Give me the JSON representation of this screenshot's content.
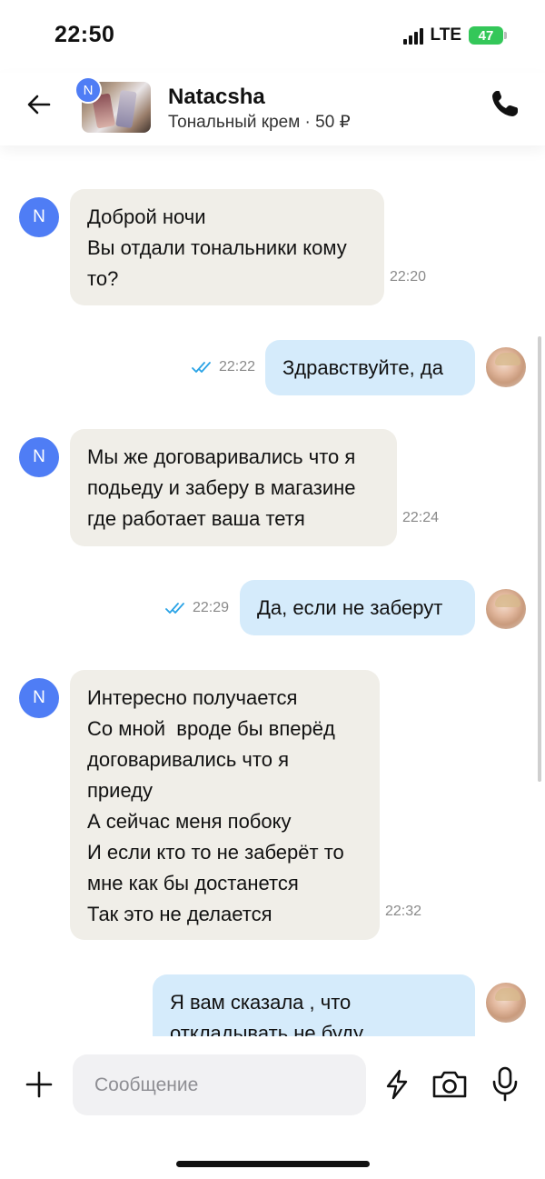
{
  "status_bar": {
    "time": "22:50",
    "network": "LTE",
    "battery": "47"
  },
  "header": {
    "avatar_letter": "N",
    "name": "Natacsha",
    "subtitle": "Тональный крем · 50 ₽",
    "back_icon": "arrow-left-icon",
    "call_icon": "phone-icon"
  },
  "messages": [
    {
      "direction": "in",
      "avatar_letter": "N",
      "lines": [
        "Доброй ночи",
        "Вы отдали тональники кому",
        "то?"
      ],
      "time": "22:20"
    },
    {
      "direction": "out",
      "lines": [
        "Здравствуйте, да"
      ],
      "time": "22:22",
      "read": true
    },
    {
      "direction": "in",
      "avatar_letter": "N",
      "lines": [
        "Мы же договаривались что я",
        "подьеду и заберу в магазине",
        "где работает ваша тетя"
      ],
      "time": "22:24"
    },
    {
      "direction": "out",
      "lines": [
        "Да, если не заберут"
      ],
      "time": "22:29",
      "read": true
    },
    {
      "direction": "in",
      "avatar_letter": "N",
      "lines": [
        "Интересно получается",
        "Со мной  вроде бы вперёд",
        "договаривались что я",
        "приеду",
        "А сейчас меня побоку",
        "И если кто то не заберёт то",
        "мне как бы достанется",
        "Так это не делается"
      ],
      "time": "22:32"
    },
    {
      "direction": "out",
      "lines": [
        "Я вам сказала , что",
        "откладывать не буду ."
      ],
      "time": "",
      "read": true
    }
  ],
  "composer": {
    "placeholder": "Сообщение",
    "value": ""
  },
  "colors": {
    "accent": "#4f7df5",
    "incoming_bubble": "#f0eee8",
    "outgoing_bubble": "#d5ebfb",
    "read_ticks": "#2aa3e6",
    "battery": "#34c759"
  }
}
